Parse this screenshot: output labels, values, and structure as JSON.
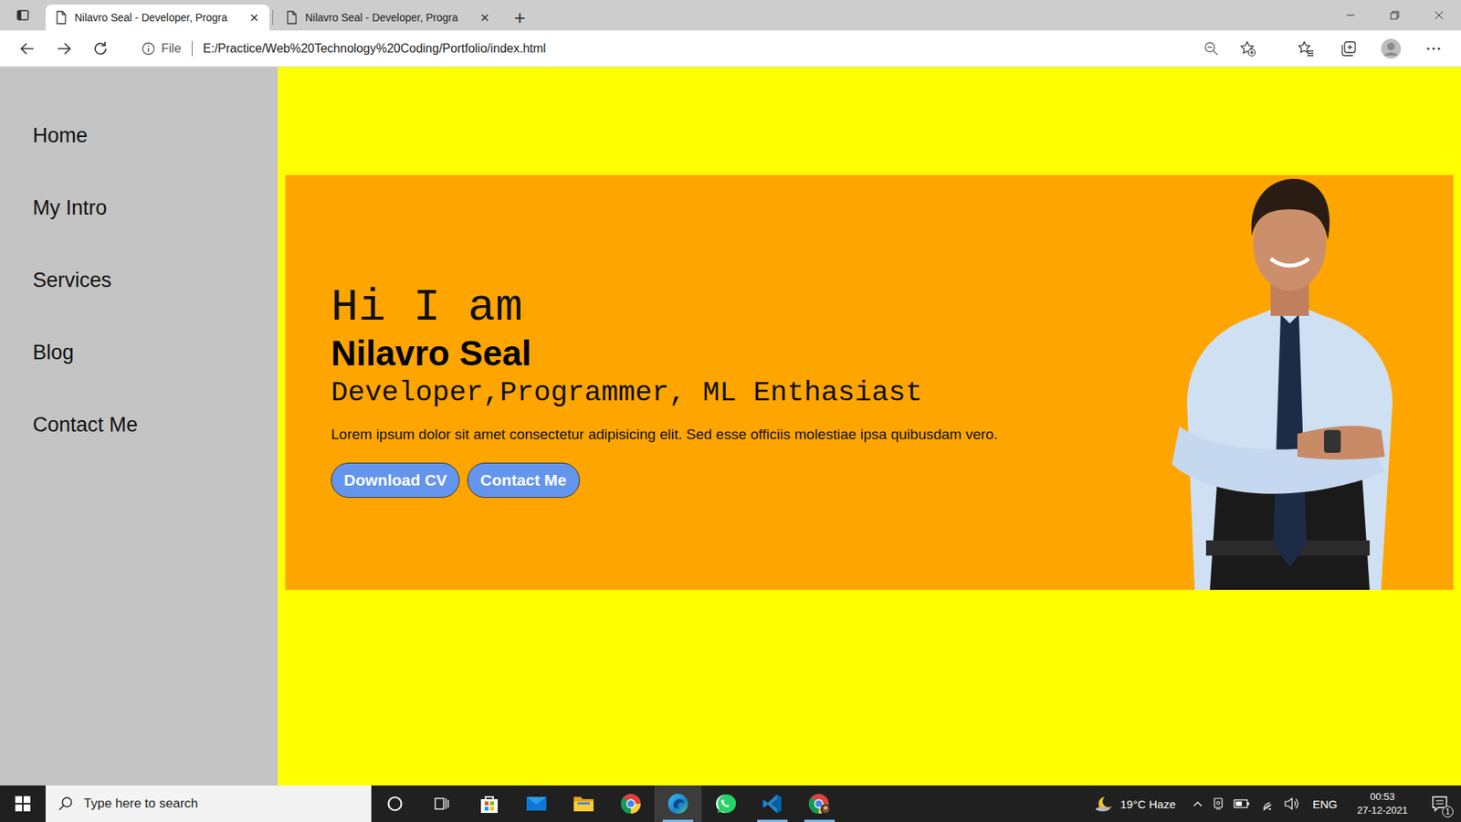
{
  "tabs": [
    {
      "label": "Nilavro Seal - Developer, Progra",
      "selected": true,
      "close": "×"
    },
    {
      "label": "Nilavro Seal - Developer, Progra",
      "selected": false,
      "close": "×"
    }
  ],
  "new_tab": "+",
  "address_bar": {
    "scheme": "File",
    "url": "E:/Practice/Web%20Technology%20Coding/Portfolio/index.html"
  },
  "sidebar": {
    "items": [
      "Home",
      "My Intro",
      "Services",
      "Blog",
      "Contact Me"
    ]
  },
  "hero": {
    "greeting": "Hi I am",
    "name": "Nilavro Seal",
    "roles": "Developer,Programmer, ML Enthasiast",
    "intro": "Lorem ipsum dolor sit amet consectetur adipisicing elit. Sed esse officiis molestiae ipsa quibusdam vero.",
    "buttons": [
      "Download CV",
      "Contact Me"
    ]
  },
  "taskbar": {
    "search": {
      "placeholder": "Type here to search"
    },
    "apps": [
      {
        "kind": "cortana",
        "running": false,
        "active": false
      },
      {
        "kind": "taskview",
        "running": false,
        "active": false
      },
      {
        "kind": "store",
        "running": false,
        "active": false
      },
      {
        "kind": "mail",
        "running": false,
        "active": false
      },
      {
        "kind": "explorer",
        "running": false,
        "active": false
      },
      {
        "kind": "chrome",
        "running": false,
        "active": false
      },
      {
        "kind": "edge",
        "running": true,
        "active": true
      },
      {
        "kind": "whatsapp",
        "running": false,
        "active": false
      },
      {
        "kind": "vscode",
        "running": true,
        "active": false
      },
      {
        "kind": "chromeprofile",
        "running": true,
        "active": false
      }
    ],
    "weather": "19°C Haze",
    "language": "ENG",
    "time": "00:53",
    "date": "27-12-2021",
    "notifications": "1"
  }
}
